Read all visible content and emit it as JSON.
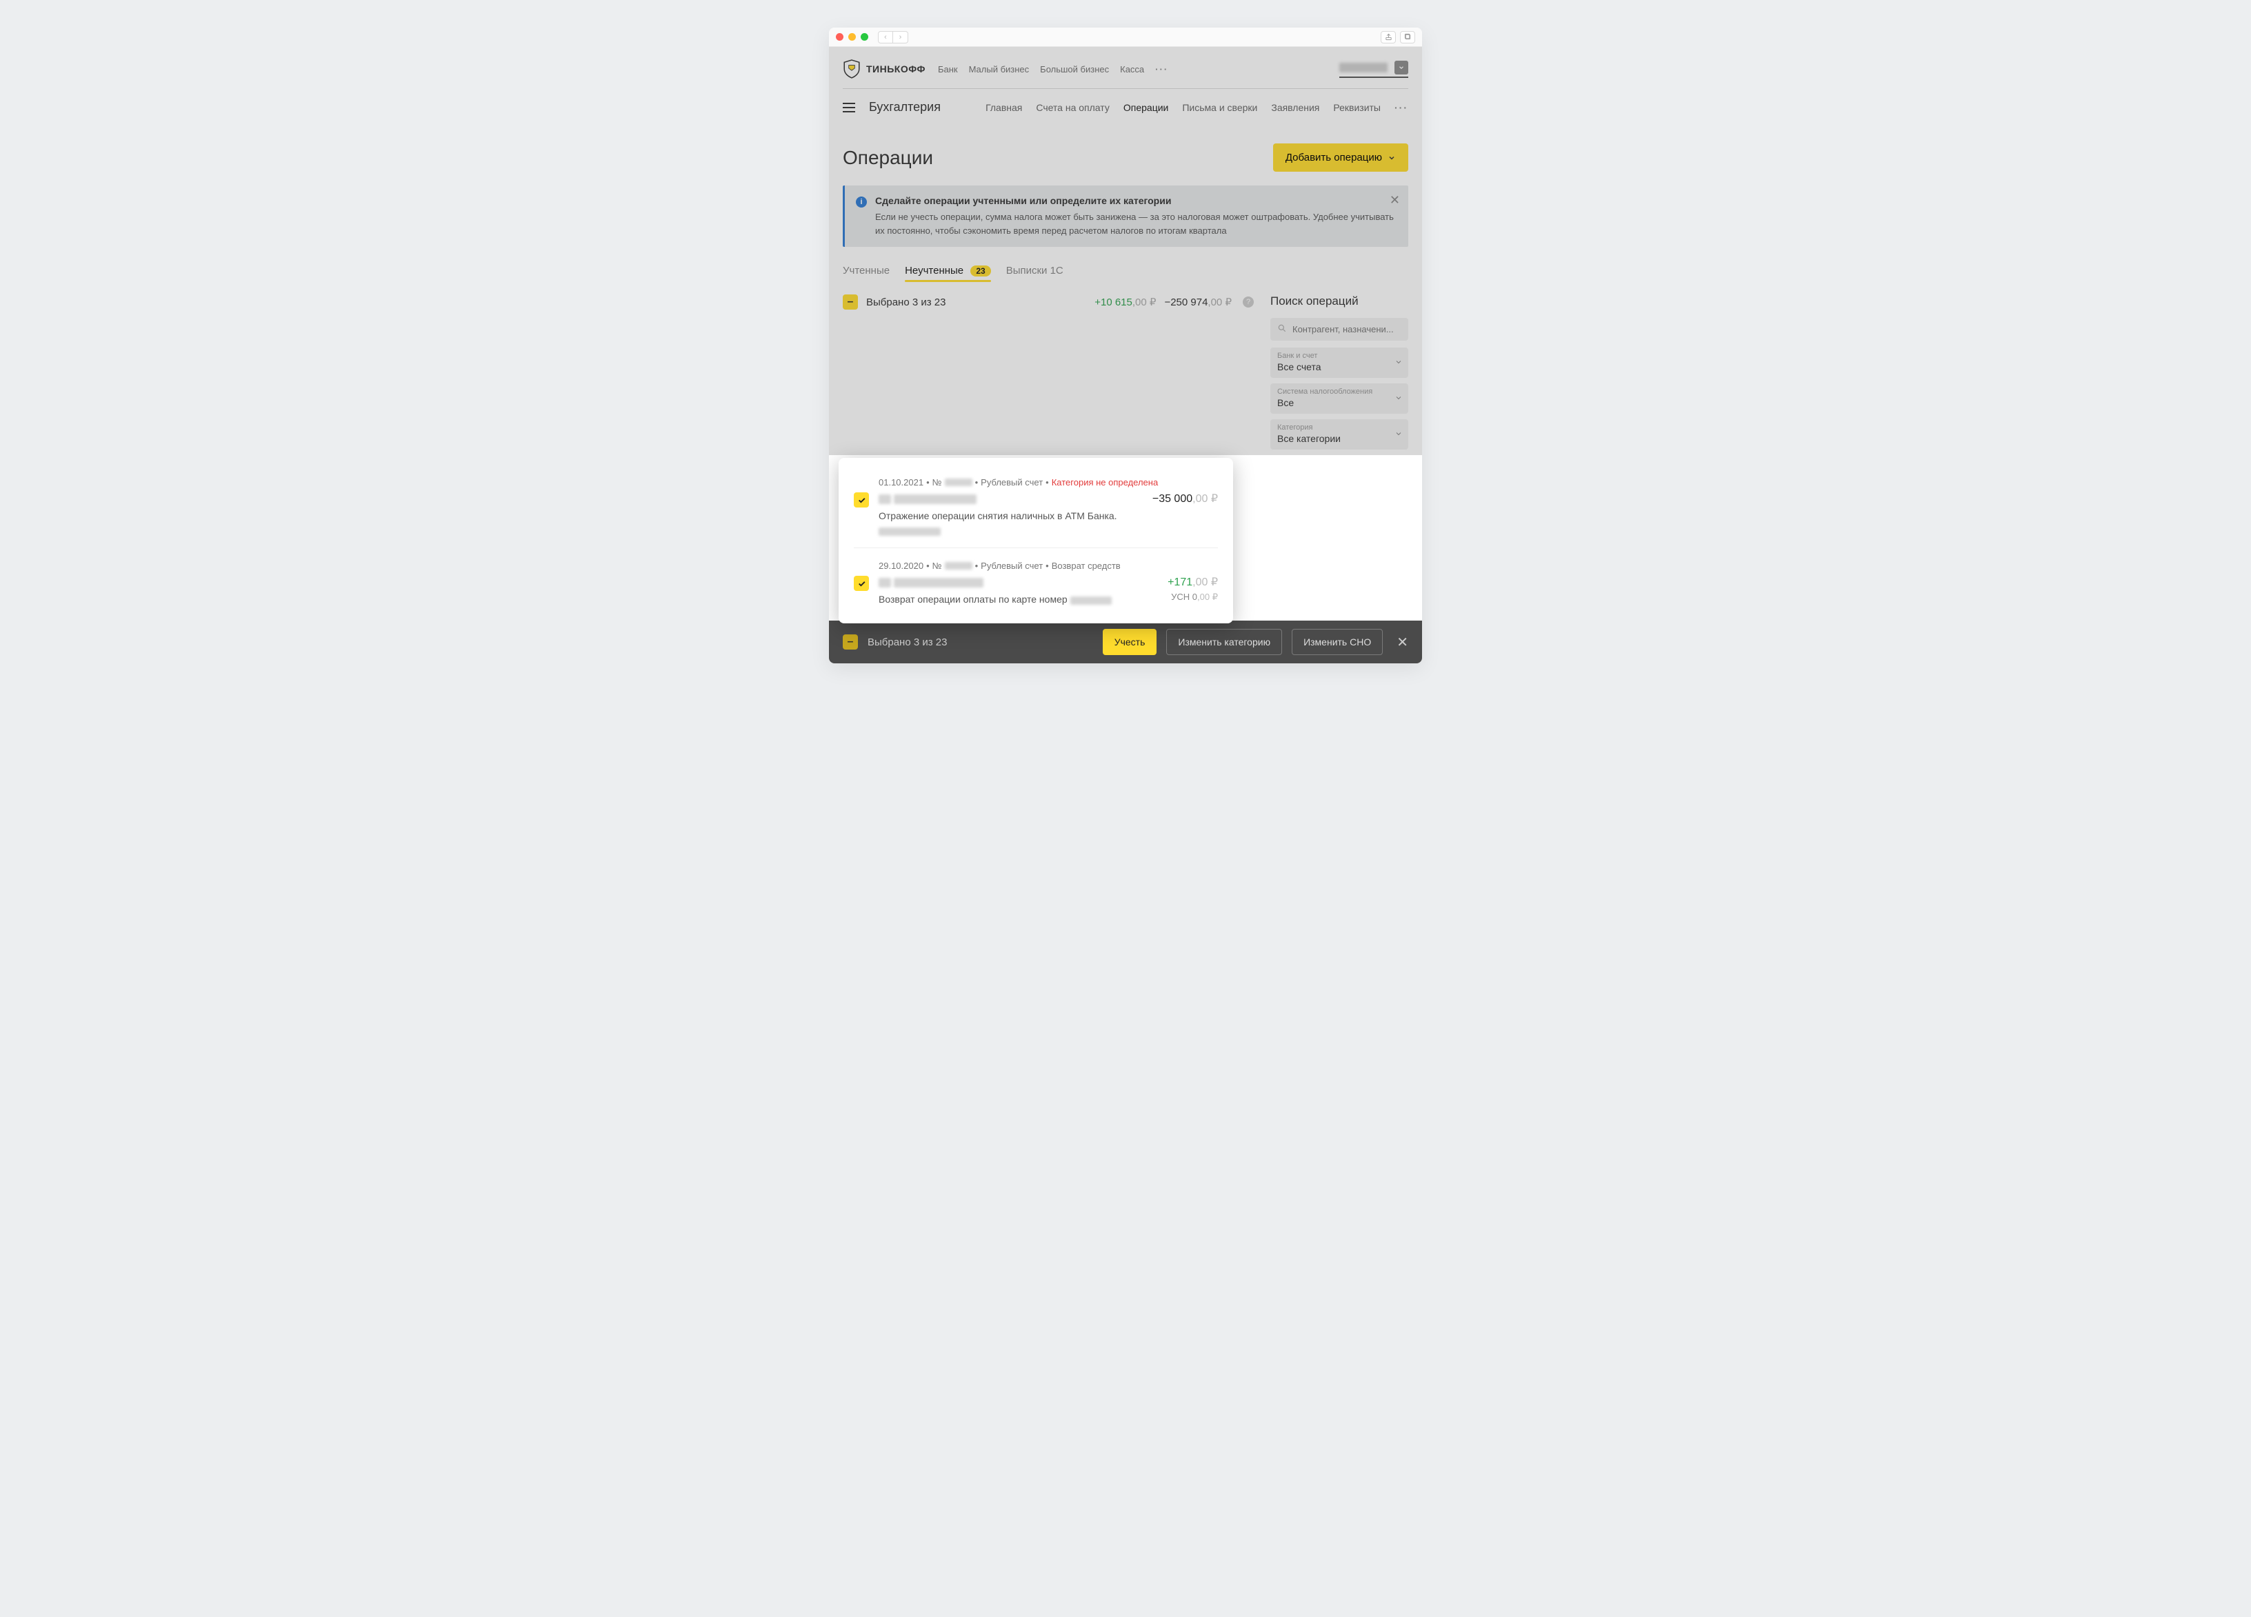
{
  "brand": "ТИНЬКОФФ",
  "top_nav": [
    "Банк",
    "Малый бизнес",
    "Большой бизнес",
    "Касса"
  ],
  "section": "Бухгалтерия",
  "sub_nav": {
    "items": [
      "Главная",
      "Счета на оплату",
      "Операции",
      "Письма и сверки",
      "Заявления",
      "Реквизиты"
    ],
    "active": "Операции"
  },
  "page_title": "Операции",
  "add_button": "Добавить операцию",
  "banner": {
    "title": "Сделайте операции учтенными или определите их категории",
    "desc": "Если не учесть операции, сумма налога может быть занижена — за это налоговая может оштрафовать. Удобнее учитывать их постоянно, чтобы сэкономить время перед расчетом налогов по итогам квартала"
  },
  "tabs": {
    "items": [
      {
        "label": "Учтенные"
      },
      {
        "label": "Неучтенные",
        "badge": "23",
        "active": true
      },
      {
        "label": "Выписки 1С"
      }
    ]
  },
  "selection_summary": {
    "label": "Выбрано 3 из 23",
    "credit": "+10 615",
    "credit_minor": ",00 ₽",
    "debit": "−250 974",
    "debit_minor": ",00 ₽"
  },
  "operations": [
    {
      "date": "01.10.2021",
      "no_prefix": "№",
      "account": "Рублевый счет",
      "category": "Категория не определена",
      "category_red": true,
      "amount_sign": "neg",
      "amount": "−35 000",
      "amount_minor": ",00 ₽",
      "desc": "Отражение операции снятия наличных в ATM Банка."
    },
    {
      "date": "29.10.2020",
      "no_prefix": "№",
      "account": "Рублевый счет",
      "category": "Возврат средств",
      "category_red": false,
      "amount_sign": "pos",
      "amount": "+171",
      "amount_minor": ",00 ₽",
      "desc": "Возврат операции оплаты по карте номер",
      "sub_label": "УСН",
      "sub_amount": "0",
      "sub_minor": ",00 ₽"
    }
  ],
  "sidebar": {
    "title": "Поиск операций",
    "search_placeholder": "Контрагент, назначени...",
    "filters": [
      {
        "label": "Банк и счет",
        "value": "Все счета"
      },
      {
        "label": "Система налогообложения",
        "value": "Все"
      },
      {
        "label": "Категория",
        "value": "Все категории"
      }
    ]
  },
  "action_bar": {
    "selected": "Выбрано 3 из 23",
    "accept": "Учесть",
    "change_category": "Изменить категорию",
    "change_sno": "Изменить СНО"
  }
}
